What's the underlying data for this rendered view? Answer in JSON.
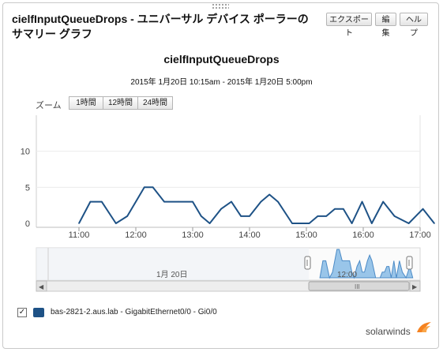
{
  "header": {
    "title": "cielfInputQueueDrops - ユニバーサル デバイス ポーラーの サマリー グラフ",
    "buttons": {
      "export": "エクスポート",
      "edit": "編集",
      "help": "ヘルプ"
    }
  },
  "chart_data": {
    "type": "area",
    "title": "cielfInputQueueDrops",
    "subtitle": "2015年 1月20日  10:15am - 2015年 1月20日  5:00pm",
    "ylim": [
      0,
      15
    ],
    "yticks": [
      "0",
      "5",
      "10"
    ],
    "xticks": [
      "11:00",
      "12:00",
      "13:00",
      "14:00",
      "15:00",
      "16:00",
      "17:00"
    ],
    "series": [
      {
        "name": "bas-2821-2.aus.lab - GigabitEthernet0/0 - Gi0/0",
        "color": "#1e5286",
        "points": [
          [
            11.0,
            0
          ],
          [
            11.2,
            3
          ],
          [
            11.4,
            3
          ],
          [
            11.65,
            0
          ],
          [
            11.85,
            1
          ],
          [
            12.15,
            5
          ],
          [
            12.3,
            5
          ],
          [
            12.5,
            3
          ],
          [
            12.75,
            3
          ],
          [
            13.0,
            3
          ],
          [
            13.15,
            1
          ],
          [
            13.3,
            0
          ],
          [
            13.5,
            2
          ],
          [
            13.68,
            3
          ],
          [
            13.85,
            1
          ],
          [
            14.0,
            1
          ],
          [
            14.2,
            3
          ],
          [
            14.35,
            4
          ],
          [
            14.5,
            3
          ],
          [
            14.75,
            0
          ],
          [
            14.9,
            0
          ],
          [
            15.05,
            0
          ],
          [
            15.2,
            1
          ],
          [
            15.35,
            1
          ],
          [
            15.5,
            2
          ],
          [
            15.65,
            2
          ],
          [
            15.8,
            0
          ],
          [
            15.98,
            3
          ],
          [
            16.15,
            0
          ],
          [
            16.35,
            3
          ],
          [
            16.55,
            1
          ],
          [
            16.8,
            0
          ],
          [
            17.05,
            2
          ],
          [
            17.25,
            0
          ]
        ]
      }
    ],
    "legend_position": "bottom-left"
  },
  "zoom": {
    "label": "ズーム",
    "options": [
      "1時間",
      "12時間",
      "24時間"
    ]
  },
  "navigator": {
    "date_label": "1月 20日",
    "time_label": "12:00",
    "scroll_handle": "III",
    "left_arrow": "◀",
    "right_arrow": "▶"
  },
  "legend": {
    "checkbox": "✓",
    "item": "bas-2821-2.aus.lab - GigabitEthernet0/0 - Gi0/0",
    "swatch_color": "#1e5286"
  },
  "brand": {
    "name": "solarwinds"
  }
}
